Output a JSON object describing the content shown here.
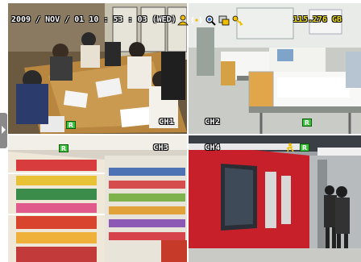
{
  "status": {
    "datetime": "2009 / NOV / 01 10 : 53 : 03 (WED)",
    "storage": "115.276 GB",
    "icons": [
      "user-icon",
      "network-icon",
      "search-icon",
      "record-icon",
      "key-icon"
    ]
  },
  "channels": [
    {
      "label": "CH1",
      "scene": "meeting-room"
    },
    {
      "label": "CH2",
      "scene": "hospital-ward"
    },
    {
      "label": "CH3",
      "scene": "supermarket"
    },
    {
      "label": "CH4",
      "scene": "subway-station"
    }
  ],
  "colors": {
    "overlay_text": "#ffffff",
    "storage_text": "#f6e31a",
    "record_icon": "#3ac23a",
    "motion_icon": "#f0c000"
  }
}
